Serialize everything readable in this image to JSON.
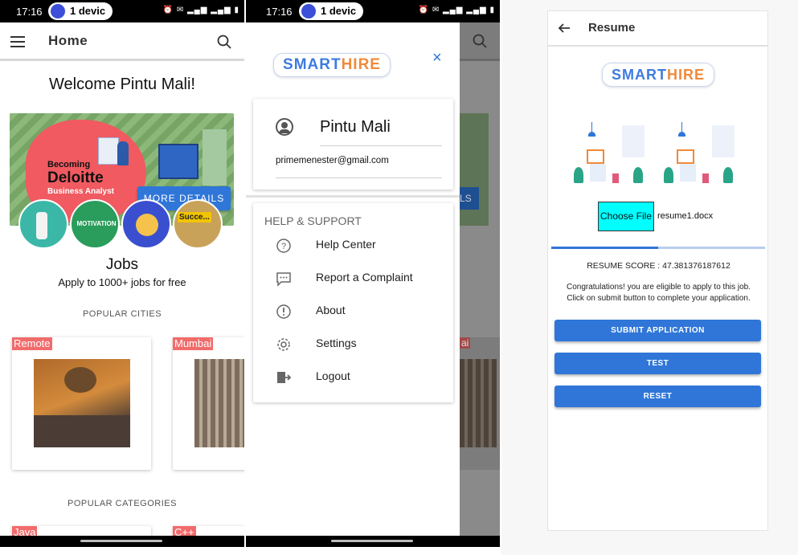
{
  "status_bar": {
    "time": "17:16",
    "device_chip": "1 devic"
  },
  "home": {
    "title": "Home",
    "welcome": "Welcome Pintu Mali!",
    "banner": {
      "line1": "Becoming",
      "line2": "Deloitte",
      "line3": "Business Analyst",
      "button": "MORE DETAILS",
      "circle_motivation": "MOTIVATION",
      "circle_success": "Succe..."
    },
    "jobs_title": "Jobs",
    "jobs_subtitle": "Apply to 1000+ jobs for free",
    "popular_cities": "POPULAR CITIES",
    "cities": [
      "Remote",
      "Mumbai"
    ],
    "popular_categories": "POPULAR CATEGORIES",
    "categories": [
      "Java",
      "C++"
    ]
  },
  "drawer": {
    "logo_part1": "SMART",
    "logo_part2": "HIRE",
    "user_name": "Pintu Mali",
    "email": "primemenester@gmail.com",
    "section": "HELP & SUPPORT",
    "items": [
      {
        "label": "Help Center",
        "icon": "help-icon"
      },
      {
        "label": "Report a Complaint",
        "icon": "chat-icon"
      },
      {
        "label": "About",
        "icon": "info-icon"
      },
      {
        "label": "Settings",
        "icon": "gear-icon"
      },
      {
        "label": "Logout",
        "icon": "logout-icon"
      }
    ],
    "behind_button_fragment": "LS",
    "behind_tag_fragment": "ai"
  },
  "resume": {
    "title": "Resume",
    "logo_part1": "SMART",
    "logo_part2": "HIRE",
    "choose_file": "Choose File",
    "file_name": "resume1.docx",
    "score_label": "RESUME SCORE : 47.381376187612",
    "score_progress": 0.5,
    "message_line1": "Congratulations! you are eligible to apply to this job.",
    "message_line2": "Click on submit button to complete your application.",
    "buttons": [
      "SUBMIT APPLICATION",
      "TEST",
      "RESET"
    ]
  },
  "colors": {
    "accent_blue": "#2f76d8",
    "tag_red": "#f26b6b",
    "choose_cyan": "#00ffff",
    "logo_blue": "#3d7be0",
    "logo_orange": "#f08a3a"
  }
}
